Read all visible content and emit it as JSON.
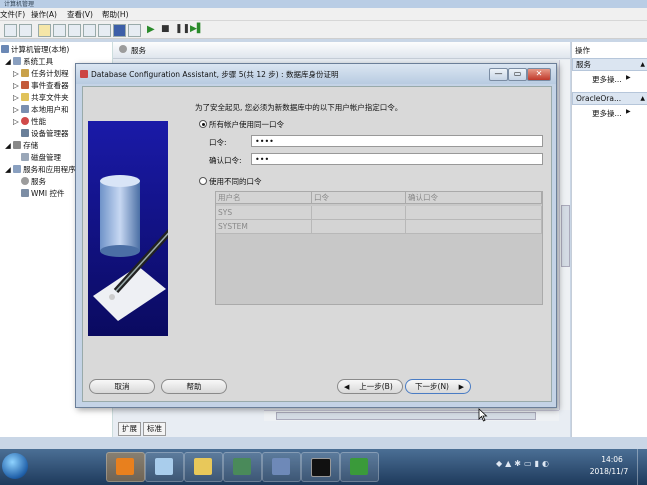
{
  "console": {
    "title": "计算机管理",
    "menu": [
      "文件(F)",
      "操作(A)",
      "查看(V)",
      "帮助(H)"
    ],
    "tree": [
      {
        "label": "计算机管理(本地)"
      },
      {
        "label": "系统工具"
      },
      {
        "label": "任务计划程"
      },
      {
        "label": "事件查看器"
      },
      {
        "label": "共享文件夹"
      },
      {
        "label": "本地用户和"
      },
      {
        "label": "性能"
      },
      {
        "label": "设备管理器"
      },
      {
        "label": "存储"
      },
      {
        "label": "磁盘管理"
      },
      {
        "label": "服务和应用程序"
      },
      {
        "label": "服务"
      },
      {
        "label": "WMI 控件"
      }
    ],
    "mid_header": "服务",
    "tabs": [
      "扩展",
      "标准"
    ],
    "actions": {
      "header": "操作",
      "group1": "服务",
      "group1_more": "更多操...",
      "group2": "OracleOra...",
      "group2_more": "更多操..."
    }
  },
  "dialog": {
    "title": "Database Configuration Assistant, 步骤 5(共 12 步) : 数据库身份证明",
    "instruction": "为了安全起见, 您必须为新数据库中的以下用户帐户指定口令。",
    "radio_same": "所有帐户使用同一口令",
    "password_label": "口令:",
    "password_value": "••••",
    "confirm_label": "确认口令:",
    "confirm_value": "•••",
    "radio_diff": "使用不同的口令",
    "table": {
      "headers": [
        "用户名",
        "口令",
        "确认口令"
      ],
      "rows": [
        [
          "SYS",
          "",
          ""
        ],
        [
          "SYSTEM",
          "",
          ""
        ]
      ]
    },
    "buttons": {
      "cancel": "取消",
      "help": "帮助",
      "back": "上一步(B)",
      "next": "下一步(N)"
    }
  },
  "taskbar": {
    "time": "14:06",
    "date": "2018/11/7"
  }
}
